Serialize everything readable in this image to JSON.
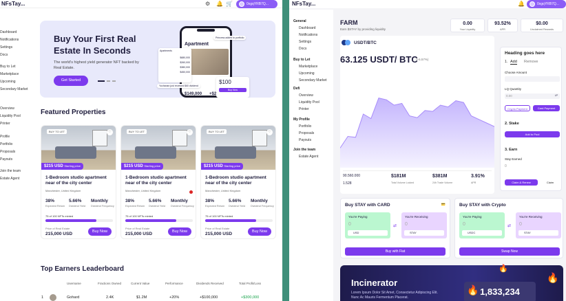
{
  "left": {
    "logo": "NFsTay...",
    "user": "0xgqYRB7Q...",
    "sidebar": [
      "Dashboard",
      "Notifications",
      "Settings",
      "Docs",
      "Buy to Let",
      "Marketplace",
      "Upcoming",
      "Secondary Market",
      "Overview",
      "Liquidity Pool",
      "Printer",
      "Profile",
      "Portfolio",
      "Proposals",
      "Payouts",
      "Join the team",
      "Estate Agent"
    ],
    "hero": {
      "title": "Buy Your First Real Estate In Seconds",
      "subtitle": "The world's highest yield generator NFT backed by Real Estate.",
      "cta": "Get Started",
      "phone_title": "Apartment",
      "phone_price_a": "$100",
      "phone_price_b": "$149,000",
      "phone_price_c": "+$2",
      "phone_note1": "Princess added to portfolio",
      "phone_note2": "Yochanan just received $60 dividend",
      "phone_buy": "Buy Now",
      "phone_list": [
        "$680,000",
        "$260,000",
        "$380,000",
        "$450,000"
      ],
      "phone_sm": "Apartments"
    },
    "featured_title": "Featured Properties",
    "cards": [
      {
        "tag": "BUY TO LET",
        "price": "$215 USD",
        "price_note": "Starting price",
        "title": "1-Bedroom studio apartment near of the city center",
        "location": "Manchester, United Kingdom",
        "s1": "38%",
        "l1": "Expected Return",
        "s2": "5.66%",
        "l2": "Dividend Yield",
        "s3": "Monthly",
        "l3": "Dividend Frequency",
        "mint": "75 of 100 NFTs minted",
        "progress": 0.75,
        "pol": "Price of Real Estate",
        "polv": "215,000 USD",
        "buy": "Buy Now"
      },
      {
        "tag": "BUY TO LET",
        "price": "$215 USD",
        "price_note": "Starting price",
        "title": "1-Bedroom studio apartment near of the city center",
        "location": "Manchester, United Kingdom",
        "s1": "38%",
        "l1": "Expected Return",
        "s2": "5.66%",
        "l2": "Dividend Yield",
        "s3": "Monthly",
        "l3": "Dividend Frequency",
        "mint": "75 of 100 NFTs minted",
        "progress": 0.75,
        "pol": "Price of Real Estate",
        "polv": "215,000 USD",
        "buy": "Buy Now"
      },
      {
        "tag": "BUY TO LET",
        "price": "$215 USD",
        "price_note": "Starting price",
        "title": "1-Bedroom studio apartment near of the city center",
        "location": "Manchester, United Kingdom",
        "s1": "38%",
        "l1": "Expected Return",
        "s2": "5.66%",
        "l2": "Dividend Yield",
        "s3": "Monthly",
        "l3": "Dividend Frequency",
        "mint": "75 of 100 NFTs minted",
        "progress": 0.75,
        "pol": "Price of Real Estate",
        "polv": "215,000 USD",
        "buy": "Buy Now"
      }
    ],
    "leaderboard": {
      "title": "Top Earners Leaderboard",
      "headers": [
        "Username",
        "Fractions Owned",
        "Current Value",
        "Performance",
        "Dividends Received",
        "Total Profit/Loss"
      ],
      "row": [
        "1",
        "Gohard",
        "2.4K",
        "$1.2M",
        "+20%",
        "+$100,000",
        "+$300,000"
      ]
    }
  },
  "right": {
    "logo": "NFsTay...",
    "user": "0xgqYRB7Q...",
    "sidebar": {
      "General": [
        "Dashboard",
        "Notifications",
        "Settings",
        "Docs"
      ],
      "Buy to Let": [
        "Marketplace",
        "Upcoming",
        "Secondary Market"
      ],
      "Defi": [
        "Overview",
        "Liquidity Pool",
        "Printer"
      ],
      "My Profile": [
        "Portfolio",
        "Proposals",
        "Payouts"
      ],
      "Join the team": [
        "Estate Agent"
      ]
    },
    "farm_title": "FARM",
    "farm_sub": "Earn $STAY by providing liquidity",
    "kpis": [
      {
        "v": "0.00",
        "l": "Your Liquidity"
      },
      {
        "v": "93.52%",
        "l": "APR"
      },
      {
        "v": "$0.00",
        "l": "Unclaimed Rewards"
      }
    ],
    "pair": "USDT/BTC",
    "price": "63.125 USDT/ BTC",
    "price_change": "(+6.57%)",
    "chart_data": {
      "type": "area",
      "values": [
        22,
        35,
        34,
        60,
        55,
        78,
        76,
        70,
        72,
        58,
        56,
        64,
        63,
        70,
        68,
        75,
        73,
        58,
        54,
        50,
        46
      ]
    },
    "stats": [
      {
        "v": "90.560.000",
        "l": ""
      },
      {
        "v": "1.528",
        "l": ""
      },
      {
        "v": "$181M",
        "l": "Total Volume Locked"
      },
      {
        "v": "$381M",
        "l": "24h Trade Volume"
      },
      {
        "v": "3.91%",
        "l": "APR"
      }
    ],
    "panel": {
      "heading": "Heading goes here",
      "tab_add": "Add",
      "tab_remove": "Remove",
      "choose": "Choose Amount",
      "lq": "LQ Quantity",
      "lq_val": "0.00",
      "lq_badge": "LP",
      "crypto_pay": "Crypto Payment",
      "card_pay": "Card Payment",
      "stake": "2. Stake",
      "add_pool": "Add to Pool",
      "earn": "3. Earn",
      "stay_earned": "Stay Earned",
      "earned_val": "0",
      "claim_renew": "Claim & Renew",
      "claim": "Claim"
    },
    "buy_card": {
      "title": "Buy STAY with CARD",
      "paying": "You're Paying",
      "receiving": "You're Receiving",
      "zero": "0",
      "from": "USD",
      "to": "STAY",
      "button": "Buy with Fiat"
    },
    "buy_crypto": {
      "title": "Buy STAY with Crypto",
      "paying": "You're Paying",
      "receiving": "You're Receiving",
      "zero": "0",
      "from": "USDC",
      "to": "STAY",
      "button": "Swap Now"
    },
    "incinerator": {
      "title": "Incinerator",
      "sub": "Lorem Ipsum Dolor Sit Amet, Consectetur Adipiscing Elit. Nunc Ac Mauris Fermentum Placerat.",
      "counter": "1,833,234"
    }
  }
}
